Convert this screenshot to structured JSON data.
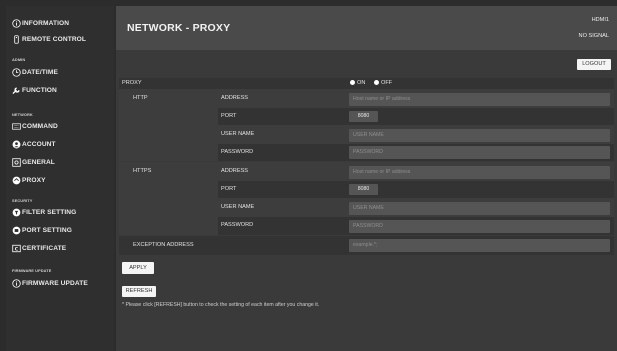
{
  "sidebar": {
    "top": [
      {
        "label": "INFORMATION",
        "icon": "info-circle-icon"
      },
      {
        "label": "REMOTE CONTROL",
        "icon": "remote-control-icon"
      }
    ],
    "sections": [
      {
        "title": "ADMIN",
        "items": [
          {
            "label": "DATE/TIME",
            "icon": "clock-icon"
          },
          {
            "label": "FUNCTION",
            "icon": "wrench-icon"
          }
        ]
      },
      {
        "title": "NETWORK",
        "items": [
          {
            "label": "COMMAND",
            "icon": "keyboard-icon"
          },
          {
            "label": "ACCOUNT",
            "icon": "account-icon"
          },
          {
            "label": "GENERAL",
            "icon": "general-icon"
          },
          {
            "label": "PROXY",
            "icon": "proxy-icon"
          }
        ]
      },
      {
        "title": "SECURITY",
        "items": [
          {
            "label": "FILTER SETTING",
            "icon": "filter-setting-icon"
          },
          {
            "label": "PORT SETTING",
            "icon": "port-setting-icon"
          },
          {
            "label": "CERTIFICATE",
            "icon": "certificate-icon"
          }
        ]
      },
      {
        "title": "FIRMWARE UPDATE",
        "items": [
          {
            "label": "FIRMWARE UPDATE",
            "icon": "info-circle-icon"
          }
        ]
      }
    ]
  },
  "header": {
    "title": "NETWORK - PROXY",
    "input_source": "HDMI1",
    "signal_status": "NO SIGNAL"
  },
  "logout_label": "LOGOUT",
  "proxy": {
    "label": "PROXY",
    "on_label": "ON",
    "off_label": "OFF",
    "selected": "ON",
    "http": {
      "label": "HTTP",
      "address_label": "ADDRESS",
      "address_placeholder": "Host name or IP address",
      "port_label": "PORT",
      "port_value": "8080",
      "username_label": "USER NAME",
      "username_placeholder": "USER NAME",
      "password_label": "PASSWORD",
      "password_placeholder": "PASSWORD"
    },
    "https": {
      "label": "HTTPS",
      "address_label": "ADDRESS",
      "address_placeholder": "Host name or IP address",
      "port_label": "PORT",
      "port_value": "8080",
      "username_label": "USER NAME",
      "username_placeholder": "USER NAME",
      "password_label": "PASSWORD",
      "password_placeholder": "PASSWORD"
    },
    "exception": {
      "label": "EXCEPTION ADDRESS",
      "placeholder": "example.*;"
    }
  },
  "apply_label": "APPLY",
  "refresh_label": "REFRESH",
  "note": "* Please click [REFRESH] button to check the setting of each item after you change it.",
  "colors": {
    "page_background": "#2c2c2c",
    "header_background": "#4a4a4a",
    "field_background": "#555555",
    "button_background": "#f4f4f4"
  }
}
